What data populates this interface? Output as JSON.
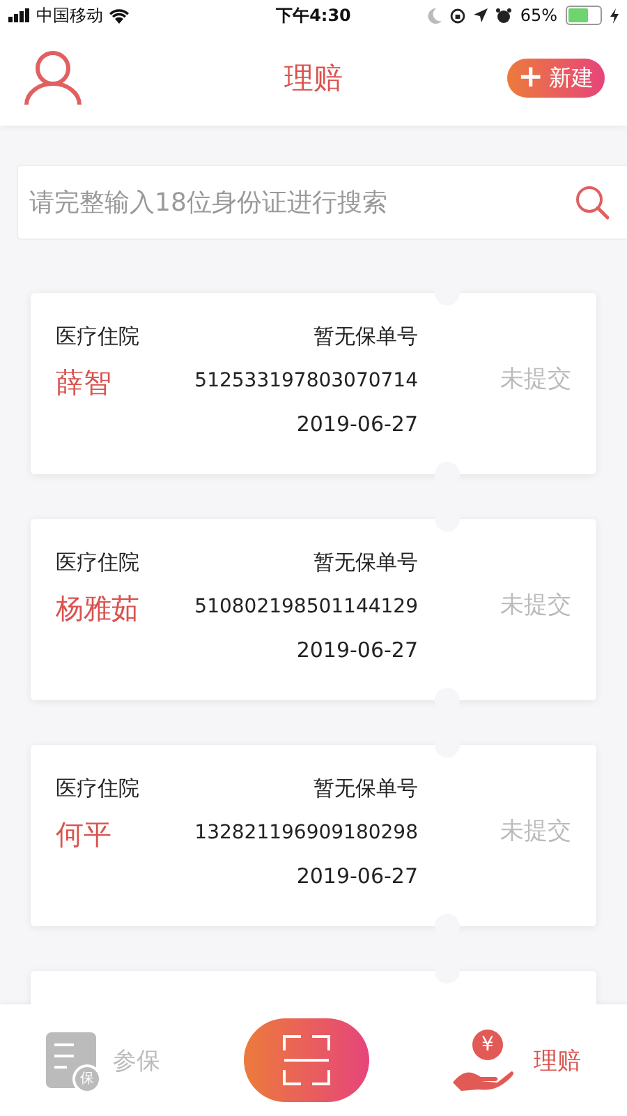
{
  "status_bar": {
    "carrier": "中国移动",
    "time": "下午4:30",
    "battery": "65%"
  },
  "header": {
    "title": "理赔",
    "new_button": {
      "icon": "+",
      "label": "新建"
    }
  },
  "search": {
    "placeholder": "请完整输入18位身份证进行搜索"
  },
  "claims": [
    {
      "type": "医疗住院",
      "policy": "暂无保单号",
      "name": "薛智",
      "id_number": "512533197803070714",
      "date": "2019-06-27",
      "status": "未提交"
    },
    {
      "type": "医疗住院",
      "policy": "暂无保单号",
      "name": "杨雅茹",
      "id_number": "510802198501144129",
      "date": "2019-06-27",
      "status": "未提交"
    },
    {
      "type": "医疗住院",
      "policy": "暂无保单号",
      "name": "何平",
      "id_number": "132821196909180298",
      "date": "2019-06-27",
      "status": "未提交"
    }
  ],
  "tabs": [
    {
      "kind": "enroll",
      "label": "参保",
      "icon_text": "保",
      "selected": false
    },
    {
      "kind": "scan"
    },
    {
      "kind": "claim",
      "label": "理赔",
      "icon_text": "¥",
      "selected": true
    }
  ]
}
